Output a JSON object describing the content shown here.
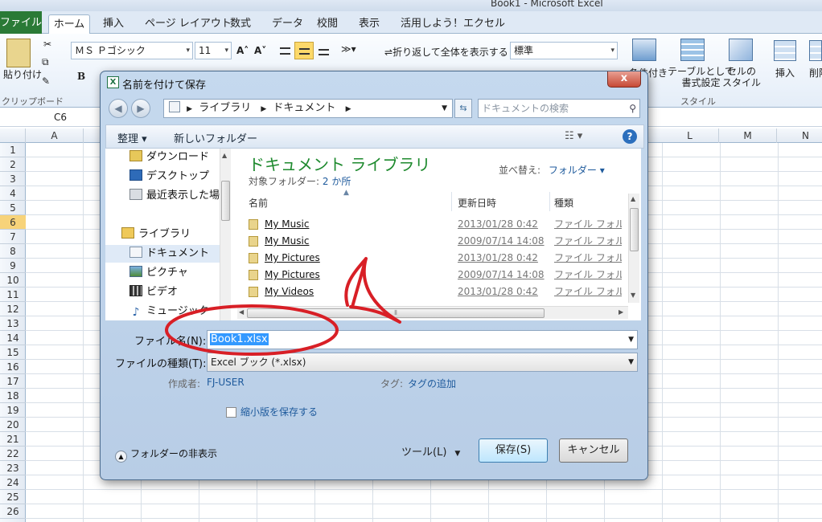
{
  "excel": {
    "title": "Book1 - Microsoft Excel",
    "tabs": [
      "ファイル",
      "ホーム",
      "挿入",
      "ページ レイアウト",
      "数式",
      "データ",
      "校閲",
      "表示",
      "活用しよう！エクセル"
    ],
    "ribbon": {
      "paste_label": "貼り付け",
      "clipboard_group": "クリップボード",
      "font_name": "ＭＳ Ｐゴシック",
      "font_size": "11",
      "bold_label": "B",
      "grow_label": "A˄",
      "shrink_label": "A˅",
      "wrap_label": "折り返して全体を表示する",
      "number_format": "標準",
      "conditional_label": "条件付き",
      "table_label": "テーブルとして\n書式設定",
      "cell_style_label": "セルの\nスタイル",
      "style_group": "スタイル",
      "insert_label": "挿入",
      "delete_label": "削除"
    },
    "name_box": "C6",
    "columns": [
      "A",
      "L",
      "M",
      "N"
    ],
    "rows": [
      "1",
      "2",
      "3",
      "4",
      "5",
      "6",
      "7",
      "8",
      "9",
      "10",
      "11",
      "12",
      "13",
      "14",
      "15",
      "16",
      "17",
      "18",
      "19",
      "20",
      "21",
      "22",
      "23",
      "24",
      "25",
      "26"
    ],
    "active_row": "6"
  },
  "dialog": {
    "title": "名前を付けて保存",
    "close_label": "x",
    "breadcrumb": [
      "ライブラリ",
      "ドキュメント"
    ],
    "search_placeholder": "ドキュメントの検索",
    "organize_label": "整理 ▾",
    "new_folder_label": "新しいフォルダー",
    "help_label": "?",
    "nav_items": [
      {
        "label": "ダウンロード"
      },
      {
        "label": "デスクトップ"
      },
      {
        "label": "最近表示した場所"
      },
      {
        "label": "ライブラリ"
      },
      {
        "label": "ドキュメント"
      },
      {
        "label": "ピクチャ"
      },
      {
        "label": "ビデオ"
      },
      {
        "label": "ミュージック"
      }
    ],
    "library_title": "ドキュメント ライブラリ",
    "library_subtitle_prefix": "対象フォルダー:",
    "library_subtitle_link": "2 か所",
    "sort_label": "並べ替え:",
    "sort_value": "フォルダー ▾",
    "columns": {
      "name": "名前",
      "modified": "更新日時",
      "type": "種類"
    },
    "files": [
      {
        "name": "My Music",
        "date": "2013/01/28 0:42",
        "type": "ファイル フォルダー"
      },
      {
        "name": "My Music",
        "date": "2009/07/14 14:08",
        "type": "ファイル フォルダー"
      },
      {
        "name": "My Pictures",
        "date": "2013/01/28 0:42",
        "type": "ファイル フォルダー"
      },
      {
        "name": "My Pictures",
        "date": "2009/07/14 14:08",
        "type": "ファイル フォルダー"
      },
      {
        "name": "My Videos",
        "date": "2013/01/28 0:42",
        "type": "ファイル フォルダー"
      }
    ],
    "filename_label": "ファイル名(N):",
    "filename_value": "Book1.xlsx",
    "filetype_label": "ファイルの種類(T):",
    "filetype_value": "Excel ブック (*.xlsx)",
    "author_label": "作成者:",
    "author_value": "FJ-USER",
    "tag_label": "タグ:",
    "tag_value": "タグの追加",
    "thumbnail_label": "縮小版を保存する",
    "hide_folders_label": "フォルダーの非表示",
    "tools_label": "ツール(L)",
    "save_label": "保存(S)",
    "cancel_label": "キャンセル"
  },
  "annotation_color": "#d81f26"
}
